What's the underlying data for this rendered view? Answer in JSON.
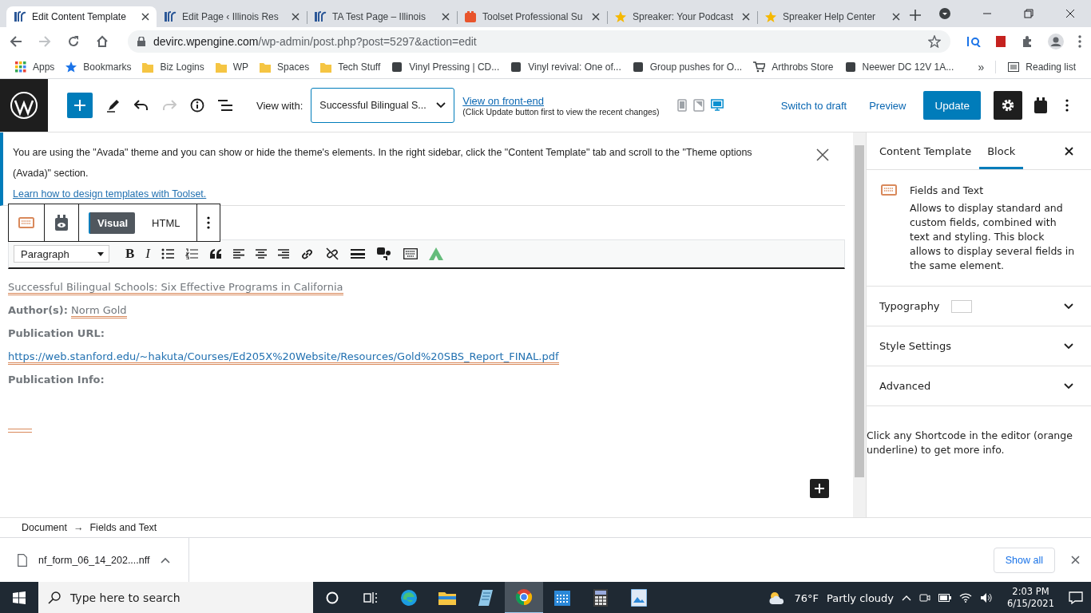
{
  "browser": {
    "tabs": [
      {
        "title": "Edit Content Template",
        "kind": "irc",
        "selected": true
      },
      {
        "title": "Edit Page ‹ Illinois Res",
        "kind": "irc",
        "selected": false
      },
      {
        "title": "TA Test Page – Illinois",
        "kind": "irc",
        "selected": false
      },
      {
        "title": "Toolset Professional Su",
        "kind": "toolset",
        "selected": false
      },
      {
        "title": "Spreaker: Your Podcast",
        "kind": "spreaker",
        "selected": false
      },
      {
        "title": "Spreaker Help Center",
        "kind": "spreaker",
        "selected": false
      }
    ],
    "url_host": "devirc.wpengine.com",
    "url_path": "/wp-admin/post.php?post=5297&action=edit",
    "bookmarks": [
      {
        "label": "Apps",
        "kind": "apps"
      },
      {
        "label": "Bookmarks",
        "kind": "star"
      },
      {
        "label": "Biz Logins",
        "kind": "folder"
      },
      {
        "label": "WP",
        "kind": "folder"
      },
      {
        "label": "Spaces",
        "kind": "folder"
      },
      {
        "label": "Tech Stuff",
        "kind": "folder"
      },
      {
        "label": "Vinyl Pressing | CD...",
        "kind": "site"
      },
      {
        "label": "Vinyl revival: One of...",
        "kind": "site"
      },
      {
        "label": "Group pushes for O...",
        "kind": "site"
      },
      {
        "label": "Arthrobs Store",
        "kind": "cart"
      },
      {
        "label": "Neewer DC 12V 1A...",
        "kind": "site"
      }
    ],
    "bookmarks_overflow": "»",
    "reading_list": "Reading list"
  },
  "wp_toolbar": {
    "tools": [
      {
        "kind": "add",
        "disabled": false
      },
      {
        "kind": "edit",
        "disabled": false
      },
      {
        "kind": "undo",
        "disabled": false
      },
      {
        "kind": "redo",
        "disabled": true
      },
      {
        "kind": "info",
        "disabled": false
      },
      {
        "kind": "outline",
        "disabled": false
      }
    ],
    "view_with_label": "View with:",
    "view_with_value": "Successful Bilingual S...",
    "front_end_link": "View on front-end",
    "front_end_note": "(Click Update button first to view the recent changes)",
    "devices": [
      {
        "kind": "mobile",
        "selected": false
      },
      {
        "kind": "tablet",
        "selected": false
      },
      {
        "kind": "desktop",
        "selected": true
      }
    ],
    "switch_to_draft": "Switch to draft",
    "preview": "Preview",
    "update": "Update",
    "settings_open": true
  },
  "notice": {
    "text": "You are using the \"Avada\" theme and you can show or hide the theme's elements. In the right sidebar, click the \"Content Template\" tab and scroll to the \"Theme options (Avada)\" section.",
    "link": "Learn how to design templates with Toolset."
  },
  "block_toolbar": {
    "modes": [
      {
        "label": "Visual",
        "selected": true
      },
      {
        "label": "HTML",
        "selected": false
      }
    ]
  },
  "format_toolbar": {
    "format": "Paragraph",
    "buttons": [
      {
        "kind": "bold",
        "glyph": "B"
      },
      {
        "kind": "italic",
        "glyph": "I"
      },
      {
        "kind": "bullet-list"
      },
      {
        "kind": "numbered-list"
      },
      {
        "kind": "quote"
      },
      {
        "kind": "align-left"
      },
      {
        "kind": "align-center"
      },
      {
        "kind": "align-right"
      },
      {
        "kind": "link"
      },
      {
        "kind": "unlink"
      },
      {
        "kind": "more"
      },
      {
        "kind": "fields"
      },
      {
        "kind": "keyboard"
      },
      {
        "kind": "avada"
      }
    ]
  },
  "content": [
    {
      "kind": "title",
      "text": "Successful Bilingual Schools: Six Effective Programs in California"
    },
    {
      "kind": "field",
      "label": "Author(s):",
      "value": "Norm Gold"
    },
    {
      "kind": "label",
      "label": "Publication URL:"
    },
    {
      "kind": "link",
      "text": "https://web.stanford.edu/~hakuta/Courses/Ed205X%20Website/Resources/Gold%20SBS_Report_FINAL.pdf"
    },
    {
      "kind": "label",
      "label": "Publication Info:"
    },
    {
      "kind": "empty-shortcode"
    }
  ],
  "breadcrumb": {
    "items": [
      "Document",
      "Fields and Text"
    ],
    "separator": "→"
  },
  "sidebar": {
    "tabs": [
      {
        "label": "Content Template",
        "selected": false
      },
      {
        "label": "Block",
        "selected": true
      }
    ],
    "block_title": "Fields and Text",
    "block_description": "Allows to display standard and custom fields, combined with text and styling. This block allows to display several fields in the same element.",
    "panels": [
      {
        "label": "Typography",
        "expanded": false
      },
      {
        "label": "Style Settings",
        "expanded": false
      },
      {
        "label": "Advanced",
        "expanded": false
      }
    ],
    "help": "Click any Shortcode in the editor (orange underline) to get more info."
  },
  "downloads": {
    "file": "nf_form_06_14_202....nff",
    "show_all": "Show all"
  },
  "taskbar": {
    "search_placeholder": "Type here to search",
    "apps": [
      {
        "kind": "cortana",
        "selected": false
      },
      {
        "kind": "task-view",
        "selected": false
      },
      {
        "kind": "edge",
        "selected": false
      },
      {
        "kind": "explorer",
        "selected": false
      },
      {
        "kind": "notepad",
        "selected": false
      },
      {
        "kind": "chrome",
        "selected": true
      },
      {
        "kind": "calendar",
        "selected": false
      },
      {
        "kind": "calculator",
        "selected": false
      },
      {
        "kind": "viewer",
        "selected": false
      }
    ],
    "temperature": "76°F",
    "weather": "Partly cloudy",
    "time": "2:03 PM",
    "date": "6/15/2021"
  }
}
